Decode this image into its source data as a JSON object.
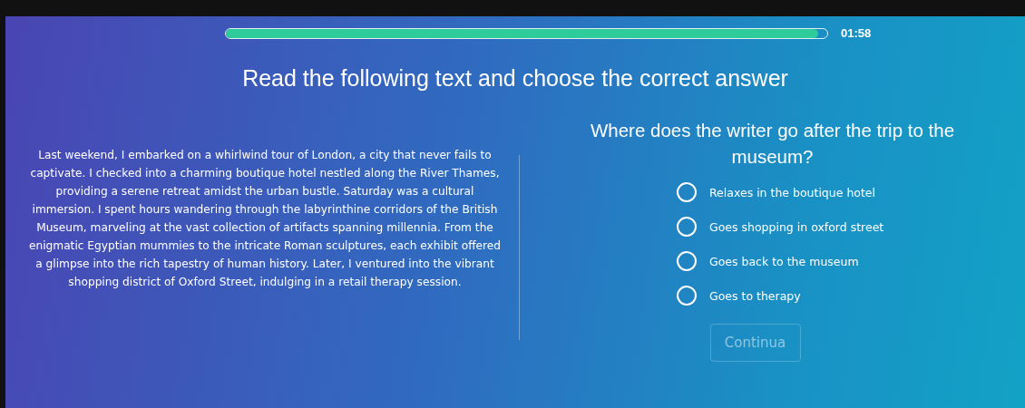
{
  "progress": {
    "level": 0.985,
    "time": "01:58"
  },
  "title": "Read the following text and choose the correct answer",
  "passage": "Last weekend, I embarked on a whirlwind tour of London, a city that never fails to captivate. I checked into a charming boutique hotel nestled along the River Thames, providing a serene retreat amidst the urban bustle. Saturday was a cultural immersion. I spent hours wandering through the labyrinthine corridors of the British Museum, marveling at the vast collection of artifacts spanning millennia. From the enigmatic Egyptian mummies to the intricate Roman sculptures, each exhibit offered a glimpse into the rich tapestry of human history. Later, I ventured into the vibrant shopping district of Oxford Street, indulging in a retail therapy session.",
  "question": "Where does the writer go after the trip to the museum?",
  "options": [
    {
      "label": "Relaxes in the boutique hotel",
      "selected": false
    },
    {
      "label": "Goes shopping in oxford street",
      "selected": false
    },
    {
      "label": "Goes back to the museum",
      "selected": false
    },
    {
      "label": "Goes to therapy",
      "selected": false
    }
  ],
  "continue_button": {
    "label": "Continua",
    "disabled": true
  }
}
